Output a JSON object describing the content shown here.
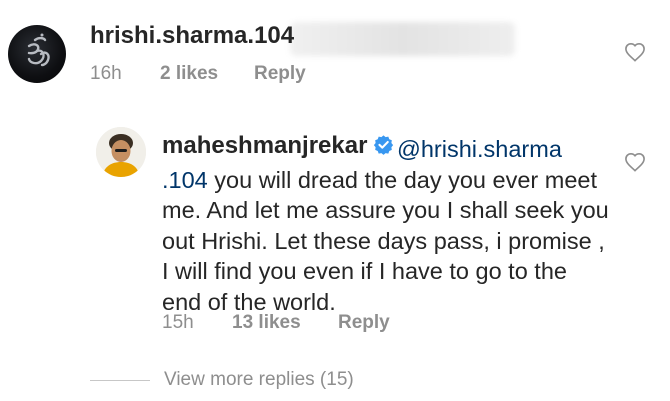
{
  "comments": [
    {
      "username": "hrishi.sharma.104",
      "time": "16h",
      "likes": "2 likes",
      "reply_label": "Reply"
    },
    {
      "username": "maheshmanjrekar",
      "mention_part1": "@hrishi.sharma",
      "mention_part2": ".104",
      "text": " you will dread the day you ever meet me. And let me assure you I shall seek you out Hrishi. Let these days pass, i promise , I will find you even if I have to go to the end of the world.",
      "time": "15h",
      "likes": "13 likes",
      "reply_label": "Reply"
    }
  ],
  "view_more": "View more replies (15)",
  "icons": {
    "like": "heart-outline-icon",
    "verified": "verified-badge-icon"
  },
  "colors": {
    "text": "#262626",
    "meta": "#8e8e8e",
    "mention": "#003569",
    "verified": "#3897f0"
  }
}
